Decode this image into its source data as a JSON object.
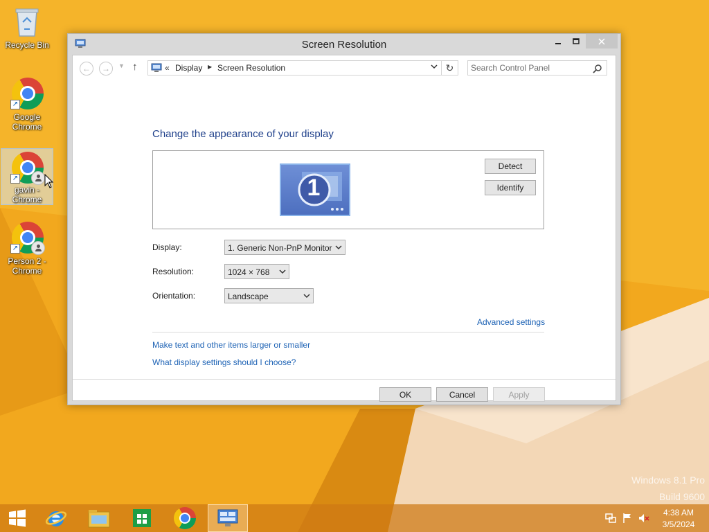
{
  "desktop": {
    "icons": [
      {
        "label": "Recycle Bin"
      },
      {
        "label": "Google\nChrome"
      },
      {
        "label": "gavin -\nChrome"
      },
      {
        "label": "Person 2 -\nChrome"
      }
    ],
    "watermark_line1": "Windows 8.1 Pro",
    "watermark_line2": "Build 9600"
  },
  "window": {
    "title": "Screen Resolution",
    "address": {
      "chevron": "«",
      "crumb_parent": "Display",
      "crumb_current": "Screen Resolution"
    },
    "search": {
      "placeholder": "Search Control Panel"
    },
    "heading": "Change the appearance of your display",
    "monitor_number": "1",
    "buttons": {
      "detect": "Detect",
      "identify": "Identify"
    },
    "fields": {
      "display": {
        "label": "Display:",
        "value": "1. Generic Non-PnP Monitor"
      },
      "resolution": {
        "label": "Resolution:",
        "value": "1024 × 768"
      },
      "orientation": {
        "label": "Orientation:",
        "value": "Landscape"
      }
    },
    "advanced_link": "Advanced settings",
    "links": {
      "larger": "Make text and other items larger or smaller",
      "choose": "What display settings should I choose?"
    },
    "footer": {
      "ok": "OK",
      "cancel": "Cancel",
      "apply": "Apply"
    }
  },
  "taskbar": {
    "items": [
      "start",
      "internet-explorer",
      "file-explorer",
      "store",
      "chrome",
      "screen-resolution"
    ],
    "active_item": "screen-resolution",
    "clock_time": "4:38 AM",
    "clock_date": "3/5/2024"
  },
  "colors": {
    "desktop_orange": "#f2a81e",
    "link_blue": "#1e63b5",
    "heading_blue": "#1e3f8a"
  }
}
